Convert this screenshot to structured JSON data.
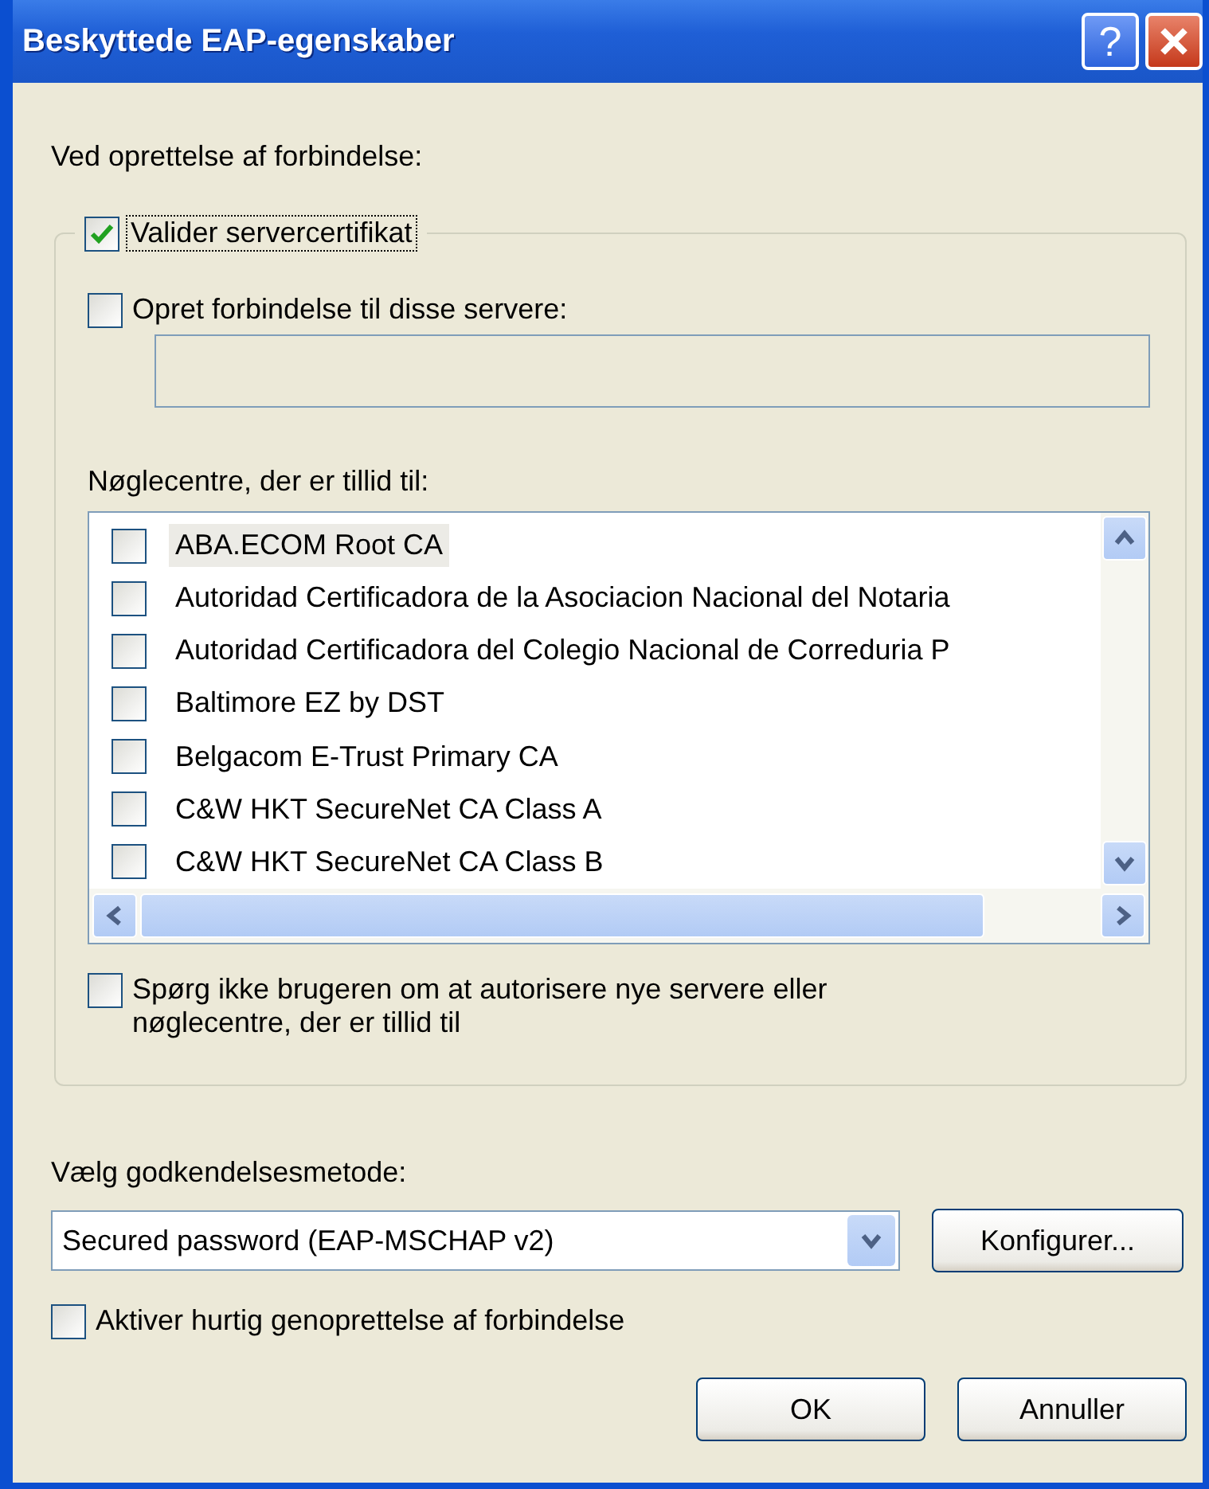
{
  "window": {
    "title": "Beskyttede EAP-egenskaber",
    "help_button": "?"
  },
  "connect_label": "Ved oprettelse af forbindelse:",
  "validate": {
    "label": "Valider servercertifikat",
    "checked": true
  },
  "connect_servers": {
    "label": "Opret forbindelse til disse servere:",
    "checked": false
  },
  "authorities_label": "Nøglecentre, der er tillid til:",
  "authorities": [
    {
      "label": "ABA.ECOM Root CA",
      "checked": false,
      "selected": true
    },
    {
      "label": "Autoridad Certificadora de la Asociacion Nacional del Notaria",
      "checked": false,
      "selected": false
    },
    {
      "label": "Autoridad Certificadora del Colegio Nacional de Correduria P",
      "checked": false,
      "selected": false
    },
    {
      "label": "Baltimore EZ by DST",
      "checked": false,
      "selected": false
    },
    {
      "label": "Belgacom E-Trust Primary CA",
      "checked": false,
      "selected": false
    },
    {
      "label": "C&W HKT SecureNet CA Class A",
      "checked": false,
      "selected": false
    },
    {
      "label": "C&W HKT SecureNet CA Class B",
      "checked": false,
      "selected": false
    }
  ],
  "dont_ask": {
    "label": "Spørg ikke brugeren om at autorisere nye servere eller nøglecentre, der er tillid til",
    "checked": false
  },
  "method_label": "Vælg godkendelsesmetode:",
  "method": {
    "value": "Secured password (EAP-MSCHAP v2)"
  },
  "configure_button": "Konfigurer...",
  "fast_reconnect": {
    "label": "Aktiver hurtig genoprettelse af forbindelse",
    "checked": false
  },
  "buttons": [
    "OK",
    "Annuller"
  ]
}
